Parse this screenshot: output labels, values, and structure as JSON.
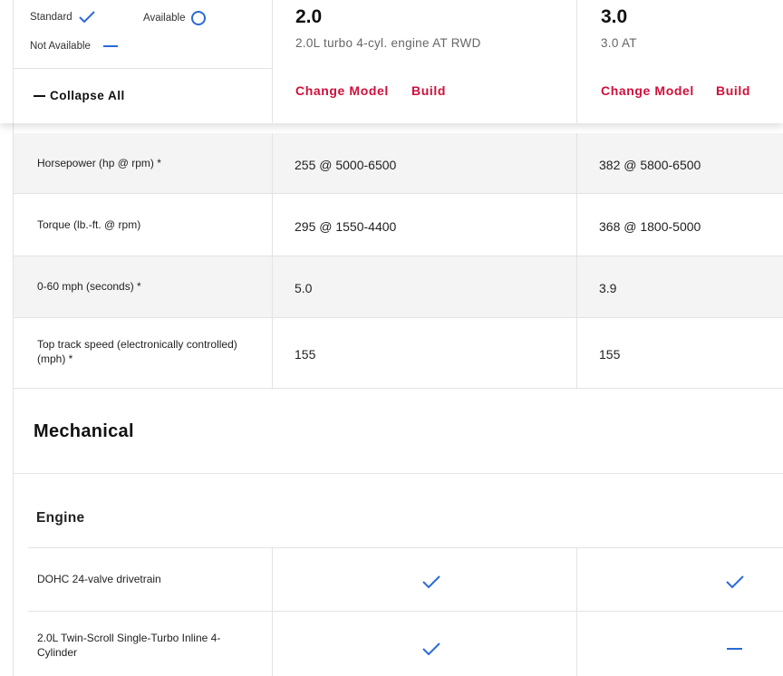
{
  "legend": {
    "standard": "Standard",
    "available": "Available",
    "not_available": "Not Available"
  },
  "collapse_label": "Collapse All",
  "models": [
    {
      "name": "2.0",
      "subtitle": "2.0L turbo 4-cyl. engine AT RWD",
      "change_label": "Change Model",
      "build_label": "Build"
    },
    {
      "name": "3.0",
      "subtitle": "3.0 AT",
      "change_label": "Change Model",
      "build_label": "Build"
    }
  ],
  "performance": [
    {
      "label": "Horsepower (hp @ rpm) *",
      "values": [
        "255 @ 5000-6500",
        "382 @ 5800-6500"
      ]
    },
    {
      "label": "Torque (lb.-ft. @ rpm)",
      "values": [
        "295 @ 1550-4400",
        "368 @ 1800-5000"
      ]
    },
    {
      "label": "0-60 mph (seconds) *",
      "values": [
        "5.0",
        "3.9"
      ]
    },
    {
      "label": "Top track speed (electronically controlled) (mph) *",
      "values": [
        "155",
        "155"
      ]
    }
  ],
  "mechanical_title": "Mechanical",
  "engine_title": "Engine",
  "engine_rows": [
    {
      "label": "DOHC 24-valve drivetrain",
      "status": [
        "standard-check-icon",
        "standard-check-icon"
      ]
    },
    {
      "label": "2.0L Twin-Scroll Single-Turbo Inline 4-Cylinder",
      "status": [
        "standard-check-icon",
        "not-available-dash-icon"
      ]
    }
  ],
  "colors": {
    "accent_red": "#d0103a",
    "icon_blue": "#2a6ad6",
    "row_gray": "#f4f4f4"
  }
}
